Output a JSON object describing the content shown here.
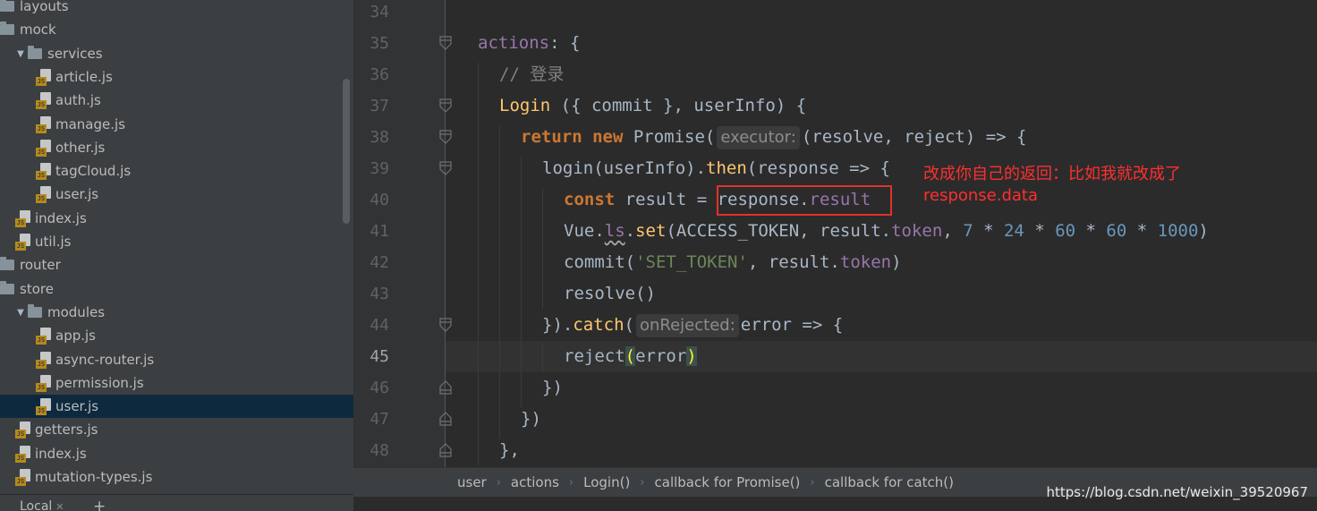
{
  "project_tree": {
    "items": [
      {
        "type": "folder",
        "label": "layouts",
        "indent": 0,
        "expanded": false
      },
      {
        "type": "folder",
        "label": "mock",
        "indent": 0,
        "expanded": false
      },
      {
        "type": "folder",
        "label": "services",
        "indent": 1,
        "expanded": true
      },
      {
        "type": "file",
        "label": "article.js",
        "indent": 2
      },
      {
        "type": "file",
        "label": "auth.js",
        "indent": 2
      },
      {
        "type": "file",
        "label": "manage.js",
        "indent": 2
      },
      {
        "type": "file",
        "label": "other.js",
        "indent": 2
      },
      {
        "type": "file",
        "label": "tagCloud.js",
        "indent": 2
      },
      {
        "type": "file",
        "label": "user.js",
        "indent": 2
      },
      {
        "type": "file",
        "label": "index.js",
        "indent": 1
      },
      {
        "type": "file",
        "label": "util.js",
        "indent": 1
      },
      {
        "type": "folder",
        "label": "router",
        "indent": 0,
        "expanded": false
      },
      {
        "type": "folder",
        "label": "store",
        "indent": 0,
        "expanded": false
      },
      {
        "type": "folder",
        "label": "modules",
        "indent": 1,
        "expanded": true
      },
      {
        "type": "file",
        "label": "app.js",
        "indent": 2
      },
      {
        "type": "file",
        "label": "async-router.js",
        "indent": 2
      },
      {
        "type": "file",
        "label": "permission.js",
        "indent": 2
      },
      {
        "type": "file",
        "label": "user.js",
        "indent": 2,
        "selected": true
      },
      {
        "type": "file",
        "label": "getters.js",
        "indent": 1
      },
      {
        "type": "file",
        "label": "index.js",
        "indent": 1
      },
      {
        "type": "file",
        "label": "mutation-types.js",
        "indent": 1
      }
    ]
  },
  "editor": {
    "line_numbers": [
      "34",
      "35",
      "36",
      "37",
      "38",
      "39",
      "40",
      "41",
      "42",
      "43",
      "44",
      "45",
      "46",
      "47",
      "48"
    ],
    "active_line": "45",
    "hints": {
      "executor": "executor:",
      "on_rejected": "onRejected:"
    },
    "annotation": {
      "line1": "改成你自己的返回：比如我就改成了",
      "line2": "response.data"
    }
  },
  "breadcrumb": {
    "items": [
      "user",
      "actions",
      "Login()",
      "callback for Promise()",
      "callback for catch()"
    ]
  },
  "watermark": "https://blog.csdn.net/weixin_39520967",
  "bottom_bar": {
    "tab_label": "Local",
    "close_glyph": "✕",
    "add_glyph": "+"
  },
  "colors": {
    "background": "#2b2b2b",
    "keyword": "#cc7832",
    "property": "#9876aa",
    "function": "#ffc66d",
    "number": "#6897bb",
    "string": "#6a8759",
    "annotation": "#ff2f2f",
    "selection": "#0d293e"
  }
}
